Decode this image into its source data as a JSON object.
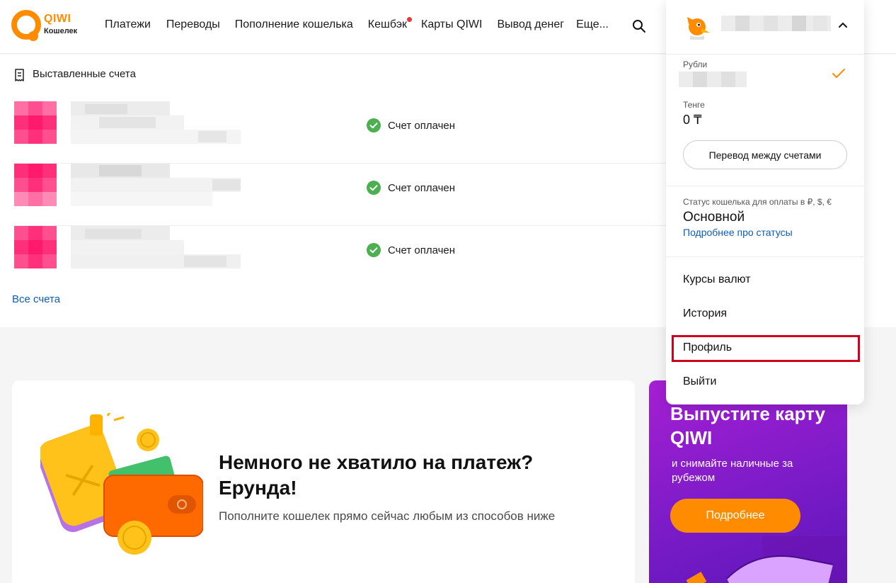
{
  "brand": {
    "name": "QIWI",
    "subtitle": "Кошелек"
  },
  "nav": {
    "items": [
      {
        "label": "Платежи"
      },
      {
        "label": "Переводы"
      },
      {
        "label": "Пополнение кошелька"
      },
      {
        "label": "Кешбэк",
        "has_dot": true
      },
      {
        "label": "Карты QIWI"
      },
      {
        "label": "Вывод денег"
      },
      {
        "label": "Еще..."
      }
    ]
  },
  "invoices": {
    "title": "Выставленные счета",
    "rows": [
      {
        "status": "Счет оплачен"
      },
      {
        "status": "Счет оплачен"
      },
      {
        "status": "Счет оплачен"
      }
    ],
    "all_link": "Все счета"
  },
  "promo": {
    "title": "Немного не хватило на платеж? Ерунда!",
    "subtitle": "Пополните кошелек прямо сейчас любым из способов ниже"
  },
  "banner": {
    "title": "Выпустите карту QIWI",
    "subtitle": "и снимайте наличные за рубежом",
    "button": "Подробнее"
  },
  "dropdown": {
    "balances": [
      {
        "label": "Рубли",
        "value": "",
        "selected": true
      },
      {
        "label": "Тенге",
        "value": "0 ₸",
        "selected": false
      }
    ],
    "transfer_button": "Перевод между счетами",
    "status_label": "Статус кошелька для оплаты в ₽, $, €",
    "status_value": "Основной",
    "status_link": "Подробнее про статусы",
    "menu": [
      {
        "label": "Курсы валют"
      },
      {
        "label": "История"
      },
      {
        "label": "Профиль",
        "highlighted": true
      },
      {
        "label": "Выйти"
      }
    ]
  },
  "colors": {
    "accent": "#ff8c00",
    "link": "#0e5cb7",
    "success": "#4caf50",
    "highlight_border": "#d0021b",
    "banner_purple": "#8a1ccc"
  }
}
